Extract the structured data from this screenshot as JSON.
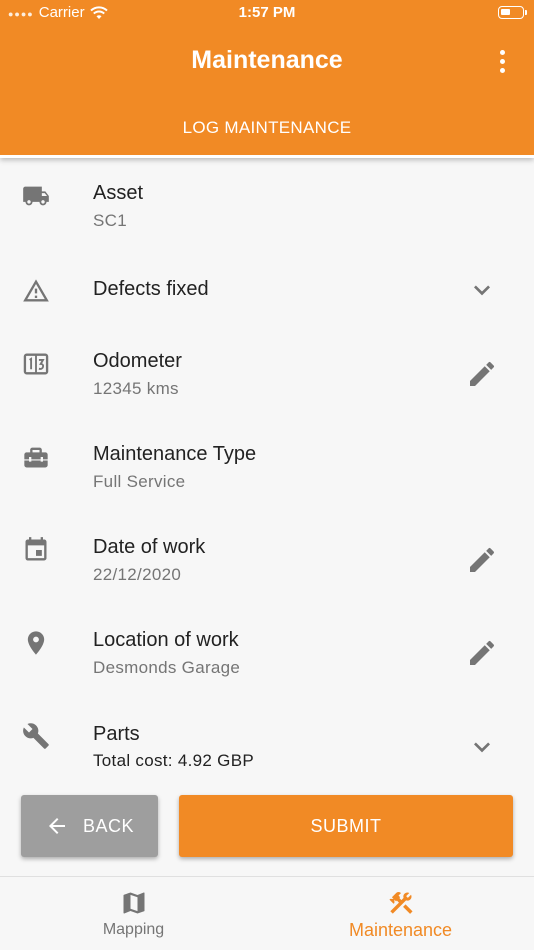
{
  "status_bar": {
    "carrier": "Carrier",
    "time": "1:57 PM"
  },
  "header": {
    "title": "Maintenance",
    "tab": "LOG MAINTENANCE"
  },
  "items": [
    {
      "title": "Asset",
      "subtitle": "SC1",
      "icon": "truck-icon"
    },
    {
      "title": "Defects fixed",
      "icon": "warning-icon",
      "action": "chevron-down-icon"
    },
    {
      "title": "Odometer",
      "subtitle": "12345 kms",
      "icon": "odometer-icon",
      "action": "edit-icon"
    },
    {
      "title": "Maintenance Type",
      "subtitle": "Full Service",
      "icon": "toolbox-icon"
    },
    {
      "title": "Date of work",
      "subtitle": "22/12/2020",
      "icon": "calendar-icon",
      "action": "edit-icon"
    },
    {
      "title": "Location of work",
      "subtitle": "Desmonds Garage",
      "icon": "location-pin-icon",
      "action": "edit-icon"
    },
    {
      "title": "Parts",
      "subtitle": "Total cost: 4.92 GBP",
      "icon": "wrench-icon",
      "action": "chevron-down-icon"
    }
  ],
  "buttons": {
    "back": "BACK",
    "submit": "SUBMIT"
  },
  "bottom_nav": [
    {
      "label": "Mapping",
      "icon": "map-icon",
      "active": false
    },
    {
      "label": "Maintenance",
      "icon": "tools-icon",
      "active": true
    }
  ],
  "colors": {
    "accent": "#f18a25",
    "secondary_button": "#9e9e9e",
    "icon_grey": "#757575"
  }
}
